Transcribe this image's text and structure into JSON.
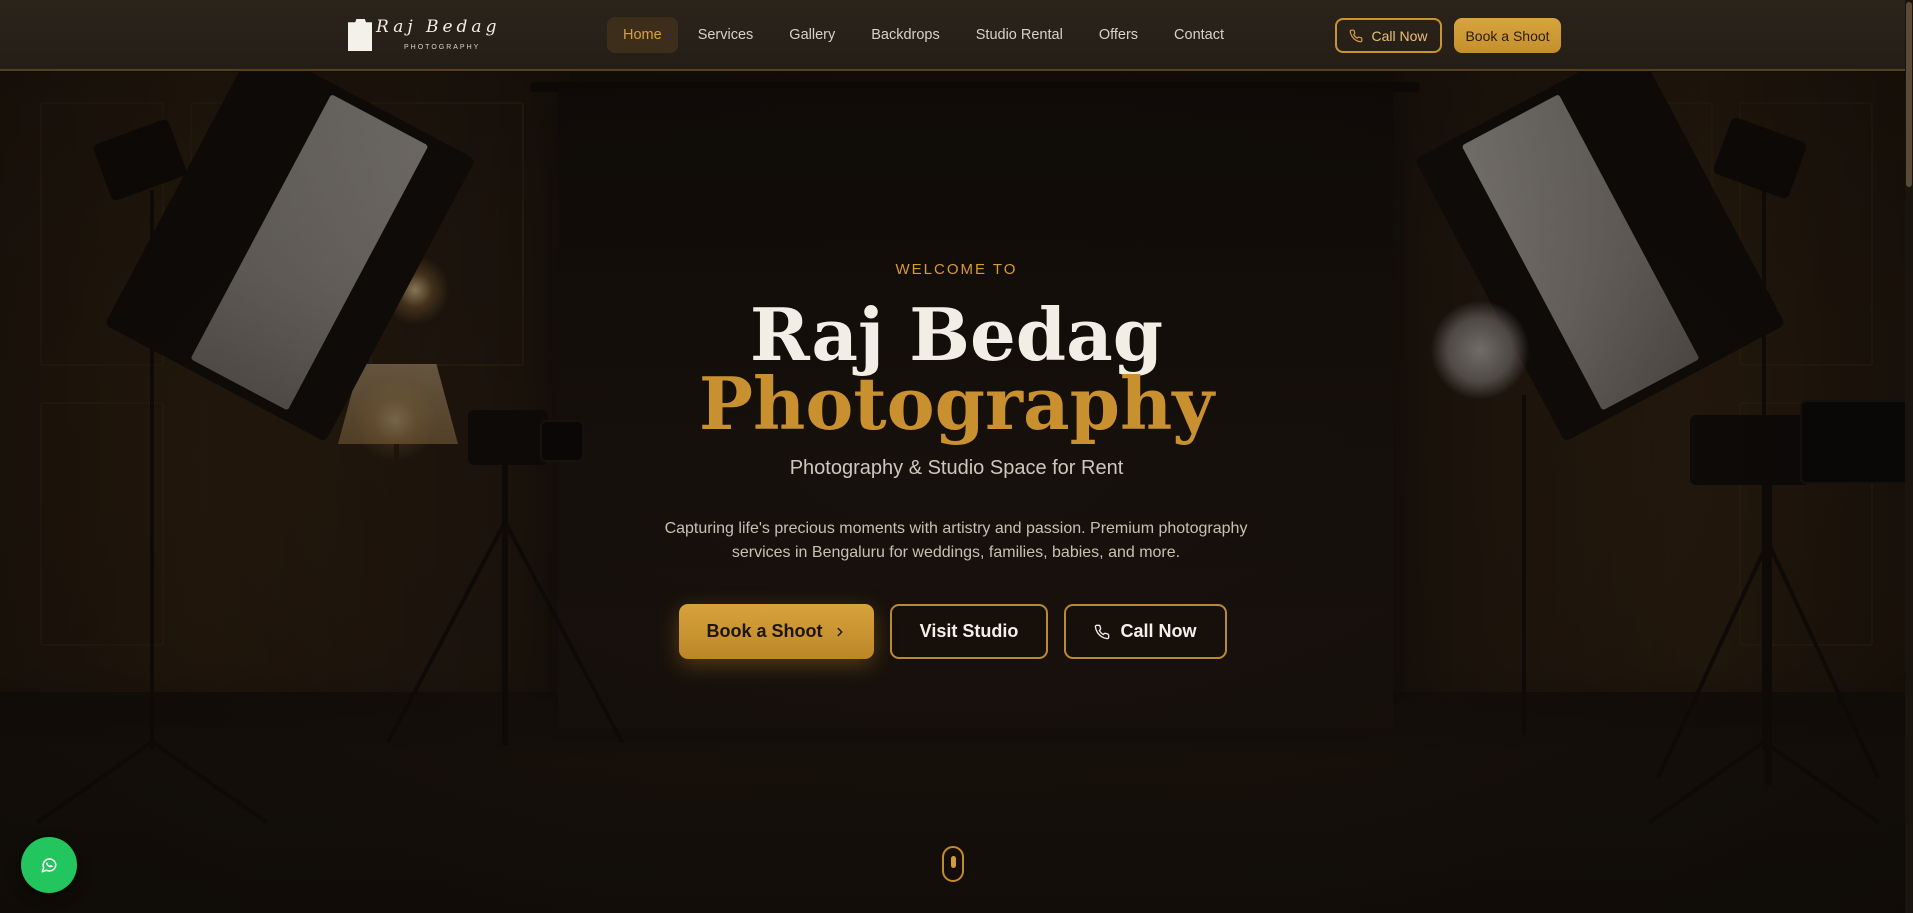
{
  "header": {
    "logo_script": "Raj Bedag",
    "logo_sub": "PHOTOGRAPHY",
    "nav": [
      {
        "label": "Home",
        "active": true
      },
      {
        "label": "Services"
      },
      {
        "label": "Gallery"
      },
      {
        "label": "Backdrops"
      },
      {
        "label": "Studio Rental"
      },
      {
        "label": "Offers"
      },
      {
        "label": "Contact"
      }
    ],
    "call_label": "Call Now",
    "book_label": "Book a Shoot"
  },
  "hero": {
    "eyebrow": "WELCOME TO",
    "title_line1": "Raj Bedag",
    "title_line2": "Photography",
    "subtitle": "Photography & Studio Space for Rent",
    "description": "Capturing life's precious moments with artistry and passion. Premium photography services in Bengaluru for weddings, families, babies, and more.",
    "buttons": {
      "book": "Book a Shoot",
      "visit": "Visit Studio",
      "call": "Call Now"
    }
  },
  "icons": {
    "phone": "phone-icon",
    "chevron": "chevron-right-icon",
    "whatsapp": "whatsapp-icon",
    "scroll": "scroll-mouse-icon"
  },
  "colors": {
    "accent": "#c99030",
    "accent_light": "#d89a33",
    "header_bg": "#2a221a",
    "whatsapp": "#22c55e",
    "text_light": "#f3eee5"
  }
}
